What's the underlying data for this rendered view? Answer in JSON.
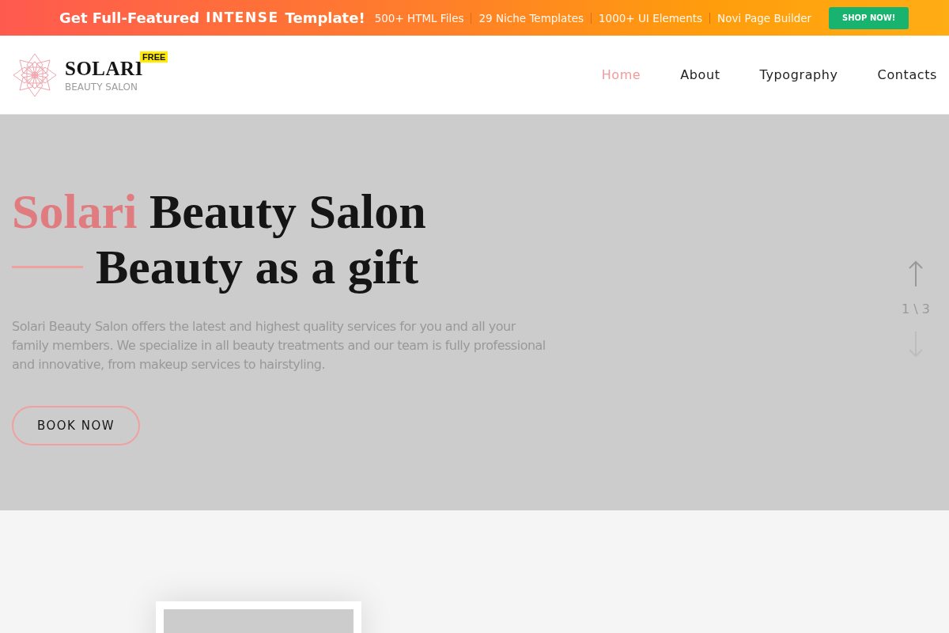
{
  "promo_bar": {
    "headline_start": "Get Full-Featured",
    "headline_brand": "INTENSE",
    "headline_end": "Template!",
    "features": [
      "500+ HTML Files",
      "29 Niche Templates",
      "1000+ UI Elements",
      "Novi Page Builder"
    ],
    "button": "SHOP NOW!"
  },
  "header": {
    "logo": {
      "name": "SOLARI",
      "badge": "FREE",
      "tagline": "BEAUTY SALON"
    },
    "nav": [
      {
        "label": "Home",
        "selected": true
      },
      {
        "label": "About",
        "selected": false
      },
      {
        "label": "Typography",
        "selected": false
      },
      {
        "label": "Contacts",
        "selected": false
      }
    ]
  },
  "hero": {
    "title_accent": "Solari",
    "title_rest": "Beauty Salon",
    "subtitle": "Beauty as a gift",
    "text": "Solari Beauty Salon offers the latest and highest quality services for you and all your family members. We specialize in all beauty treatments and our team is fully professional and innovative, from makeup services to hairstyling.",
    "button": "BOOK NOW",
    "slider": {
      "counter": "1 \\ 3",
      "prev_disabled": false,
      "next_disabled": true
    }
  }
}
